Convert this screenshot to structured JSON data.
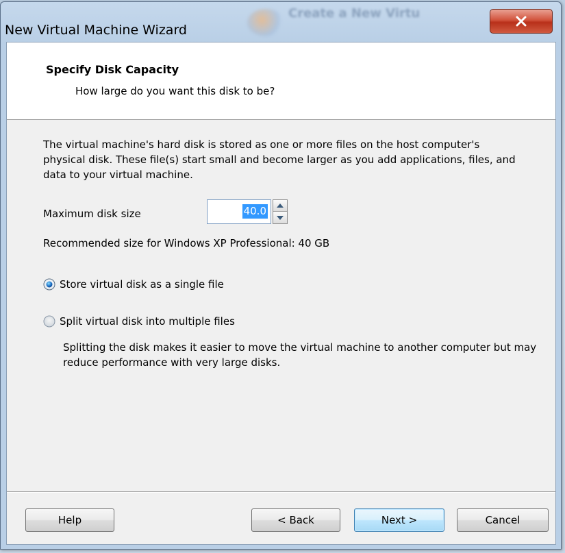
{
  "window": {
    "title": "New Virtual Machine Wizard",
    "background_title": "Create a New Virtu",
    "close_glyph": "X"
  },
  "header": {
    "title": "Specify Disk Capacity",
    "subtitle": "How large do you want this disk to be?"
  },
  "content": {
    "description": "The virtual machine's hard disk is stored as one or more files on the host computer's physical disk. These file(s) start small and become larger as you add applications, files, and data to your virtual machine.",
    "max_size_label": "Maximum disk size",
    "max_size_value": "40.0",
    "recommended": "Recommended size for Windows XP Professional: 40 GB",
    "options": {
      "single_label": "Store virtual disk as a single file",
      "single_selected": true,
      "split_label": "Split virtual disk into multiple files",
      "split_selected": false
    },
    "split_description": "Splitting the disk makes it easier to move the virtual machine to another computer but may reduce performance with very large disks."
  },
  "buttons": {
    "help": "Help",
    "back": "< Back",
    "next": "Next >",
    "cancel": "Cancel"
  },
  "colors": {
    "selection": "#3399ff",
    "close_button": "#c8452e",
    "default_button_border": "#3c7fb1"
  }
}
